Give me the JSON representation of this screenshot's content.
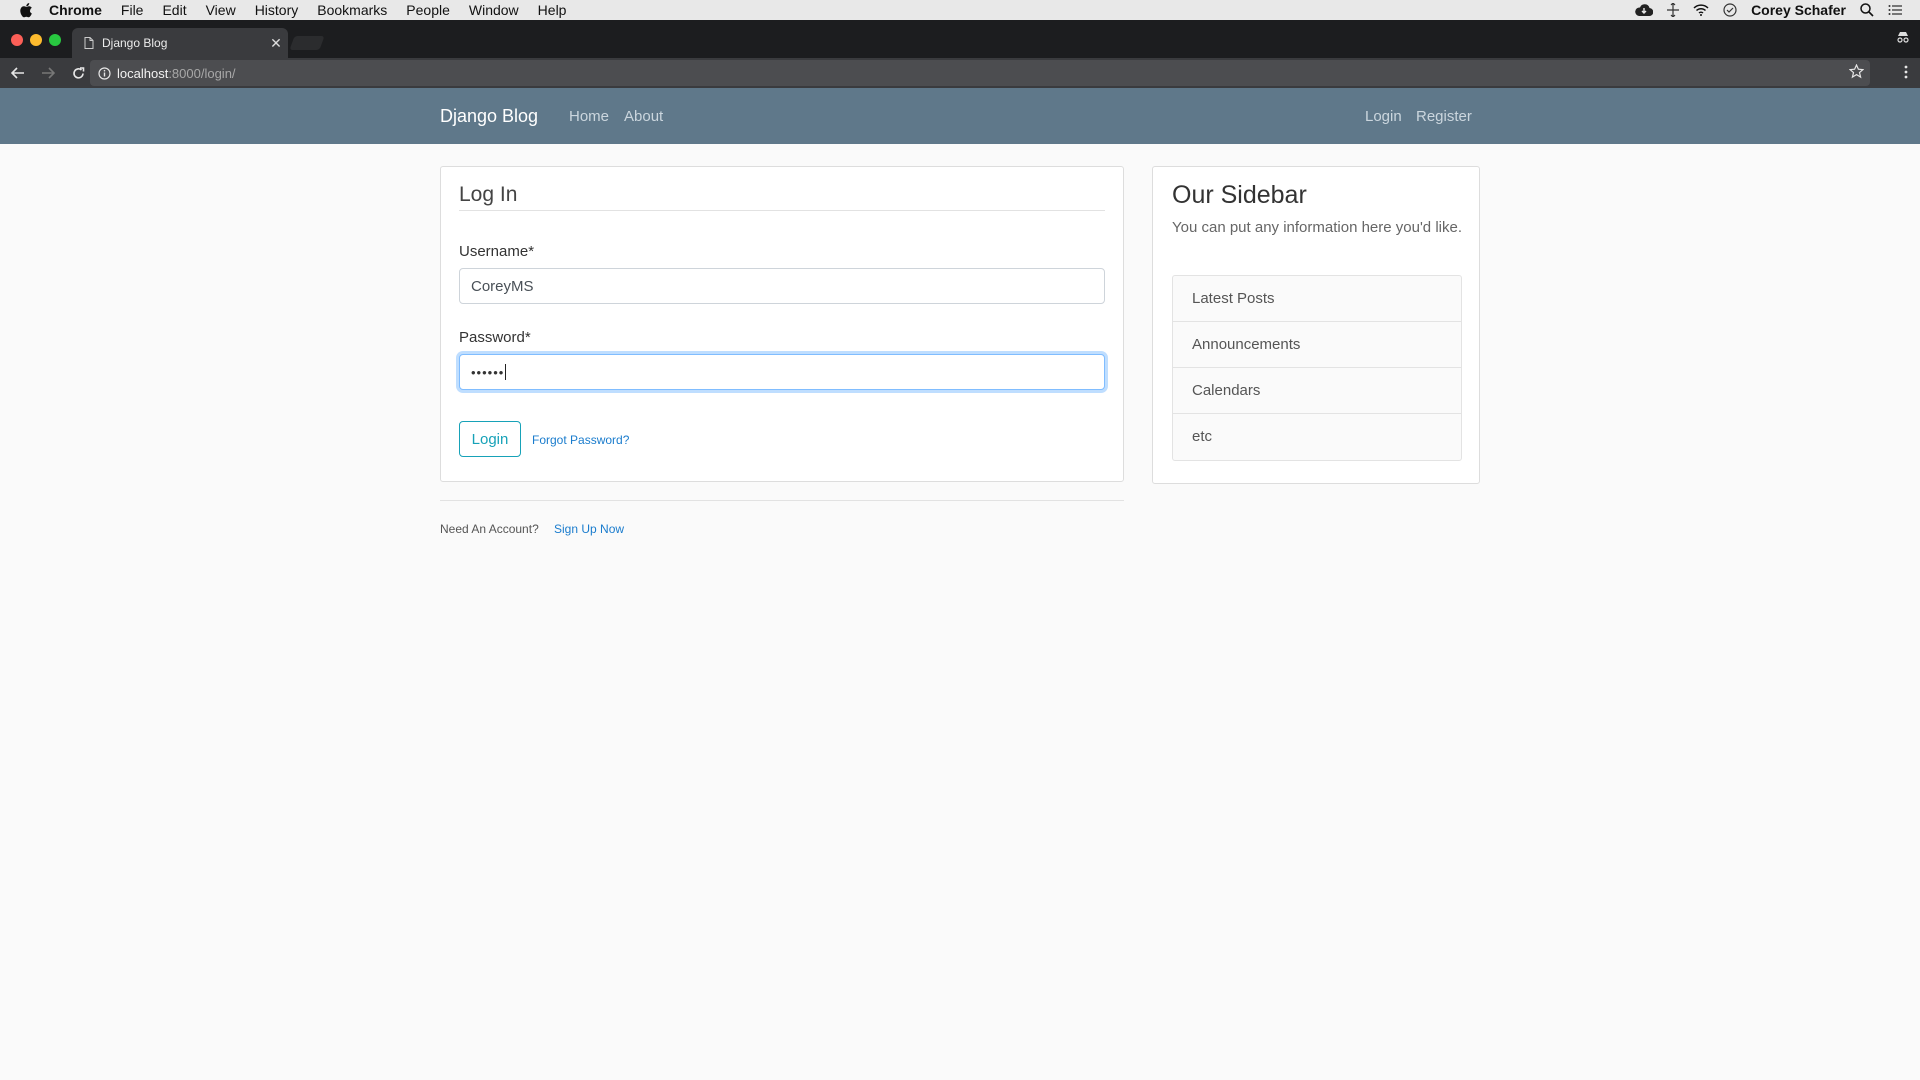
{
  "menubar": {
    "app": "Chrome",
    "items": [
      "File",
      "Edit",
      "View",
      "History",
      "Bookmarks",
      "People",
      "Window",
      "Help"
    ],
    "user": "Corey Schafer"
  },
  "browser": {
    "tab_title": "Django Blog",
    "url_host": "localhost",
    "url_path": ":8000/login/"
  },
  "navbar": {
    "brand": "Django Blog",
    "home": "Home",
    "about": "About",
    "login": "Login",
    "register": "Register"
  },
  "login_form": {
    "legend": "Log In",
    "username_label": "Username*",
    "username_value": "CoreyMS",
    "password_label": "Password*",
    "password_value": "••••••",
    "submit_label": "Login",
    "forgot_link": "Forgot Password?",
    "need_account": "Need An Account?",
    "signup_link": "Sign Up Now"
  },
  "sidebar": {
    "title": "Our Sidebar",
    "text": "You can put any information here you'd like.",
    "items": [
      "Latest Posts",
      "Announcements",
      "Calendars",
      "etc"
    ]
  },
  "colors": {
    "navbar": "#5f788a",
    "accent_button": "#17a2b8",
    "link": "#1a7ccd"
  }
}
